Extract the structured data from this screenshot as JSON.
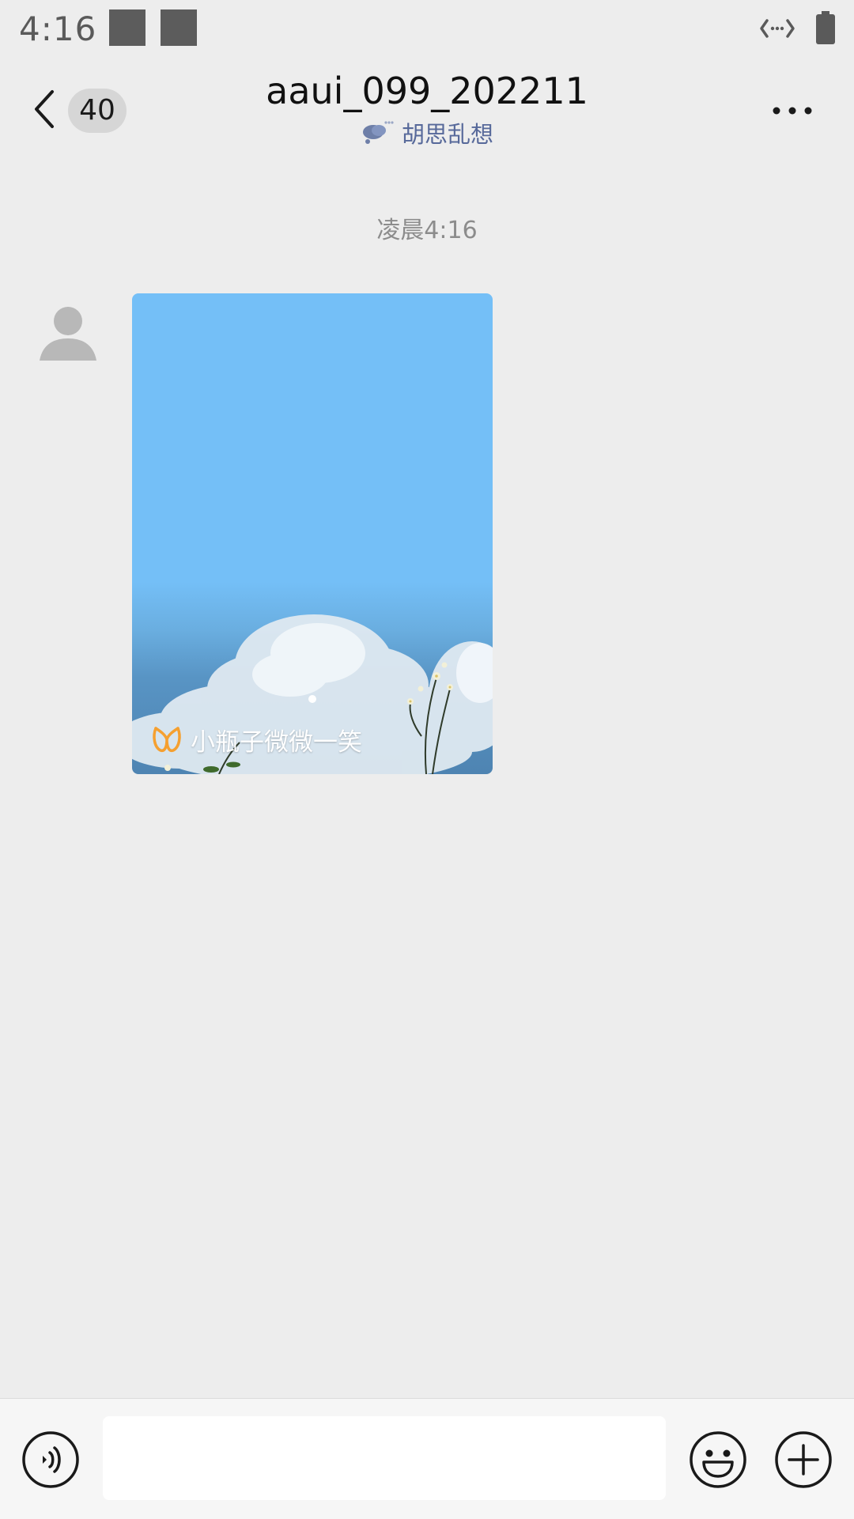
{
  "status_bar": {
    "time": "4:16",
    "icons": [
      "notification-square-icon",
      "notification-square-icon",
      "data-transfer-icon",
      "battery-icon"
    ]
  },
  "header": {
    "unread_count": "40",
    "title": "aaui_099_202211",
    "status_text": "胡思乱想",
    "status_icon": "thought-bubble-icon",
    "more_icon": "more-dots-icon",
    "back_icon": "chevron-left-icon"
  },
  "chat": {
    "timestamp": "凌晨4:16",
    "messages": [
      {
        "sender_avatar": "default-avatar-icon",
        "type": "bottle-card",
        "caption": "小瓶子微微一笑",
        "caption_icon": "bottle-logo-icon"
      }
    ]
  },
  "input_bar": {
    "voice_icon": "voice-icon",
    "input_value": "",
    "input_placeholder": "",
    "emoji_icon": "emoji-icon",
    "plus_icon": "plus-icon"
  },
  "colors": {
    "background": "#ededed",
    "status_text": "#57699a",
    "card_sky": "#74bff7",
    "bottle_logo": "#f5a030"
  }
}
